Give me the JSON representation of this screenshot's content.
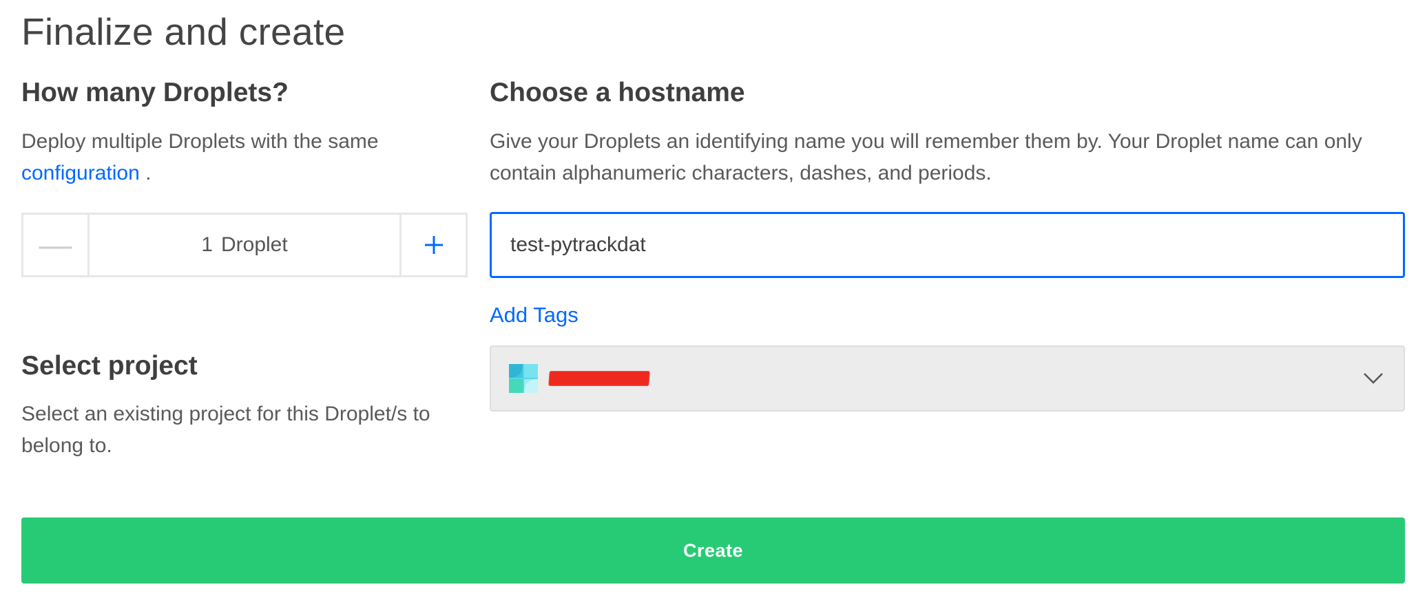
{
  "page": {
    "title": "Finalize and create"
  },
  "droplets": {
    "heading": "How many Droplets?",
    "description": "Deploy multiple Droplets with the same",
    "link_label": "configuration",
    "link_suffix": " .",
    "count": "1",
    "unit": "Droplet",
    "decrement_symbol": "—",
    "increment_symbol": "+"
  },
  "hostname": {
    "heading": "Choose a hostname",
    "description": "Give your Droplets an identifying name you will remember them by. Your Droplet name can only contain alphanumeric characters, dashes, and periods.",
    "value": "test-pytrackdat",
    "add_tags_label": "Add Tags"
  },
  "project": {
    "heading": "Select project",
    "description": "Select an existing project for this Droplet/s to belong to.",
    "icon": "project-icon",
    "dropdown_icon": "chevron-down-icon"
  },
  "actions": {
    "create_label": "Create"
  },
  "colors": {
    "accent": "#0069ff",
    "create": "#28cb75",
    "redaction": "#ee2a1f"
  }
}
